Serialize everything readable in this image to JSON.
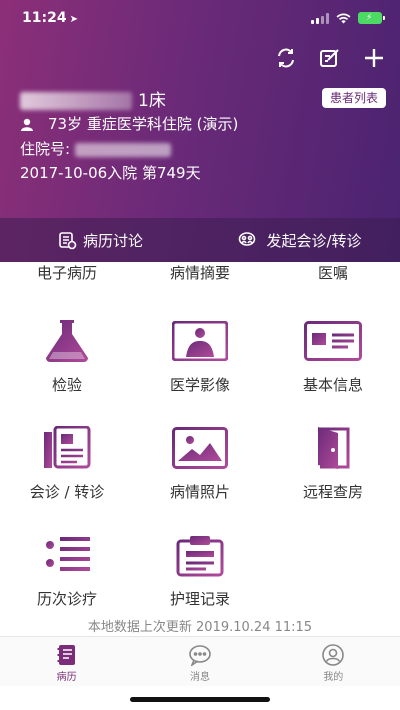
{
  "status_bar": {
    "time": "11:24",
    "battery_text": "⚡"
  },
  "header": {
    "patient_name_suffix": "1床",
    "list_button": "患者列表",
    "age_dept": "73岁  重症医学科住院 (演示)",
    "hospital_no_label": "住院号: ",
    "admission": "2017-10-06入院   第749天"
  },
  "top_tabs": {
    "discussion": "病历讨论",
    "consult": "发起会诊/转诊"
  },
  "grid": {
    "row0": [
      "电子病历",
      "病情摘要",
      "医嘱"
    ],
    "items": [
      {
        "label": "检验",
        "icon": "flask-icon"
      },
      {
        "label": "医学影像",
        "icon": "xray-icon"
      },
      {
        "label": "基本信息",
        "icon": "id-card-icon"
      },
      {
        "label": "会诊 / 转诊",
        "icon": "documents-icon"
      },
      {
        "label": "病情照片",
        "icon": "photo-icon"
      },
      {
        "label": "远程查房",
        "icon": "door-icon"
      },
      {
        "label": "历次诊疗",
        "icon": "timeline-icon"
      },
      {
        "label": "护理记录",
        "icon": "clipboard-icon"
      }
    ]
  },
  "footer_note": "本地数据上次更新 2019.10.24 11:15",
  "bottom_nav": {
    "records": "病历",
    "messages": "消息",
    "mine": "我的"
  },
  "colors": {
    "accent": "#7b2d7a",
    "header_start": "#8c2f78",
    "header_end": "#4a2370",
    "icon_gradient_end": "#8a3a9a"
  }
}
